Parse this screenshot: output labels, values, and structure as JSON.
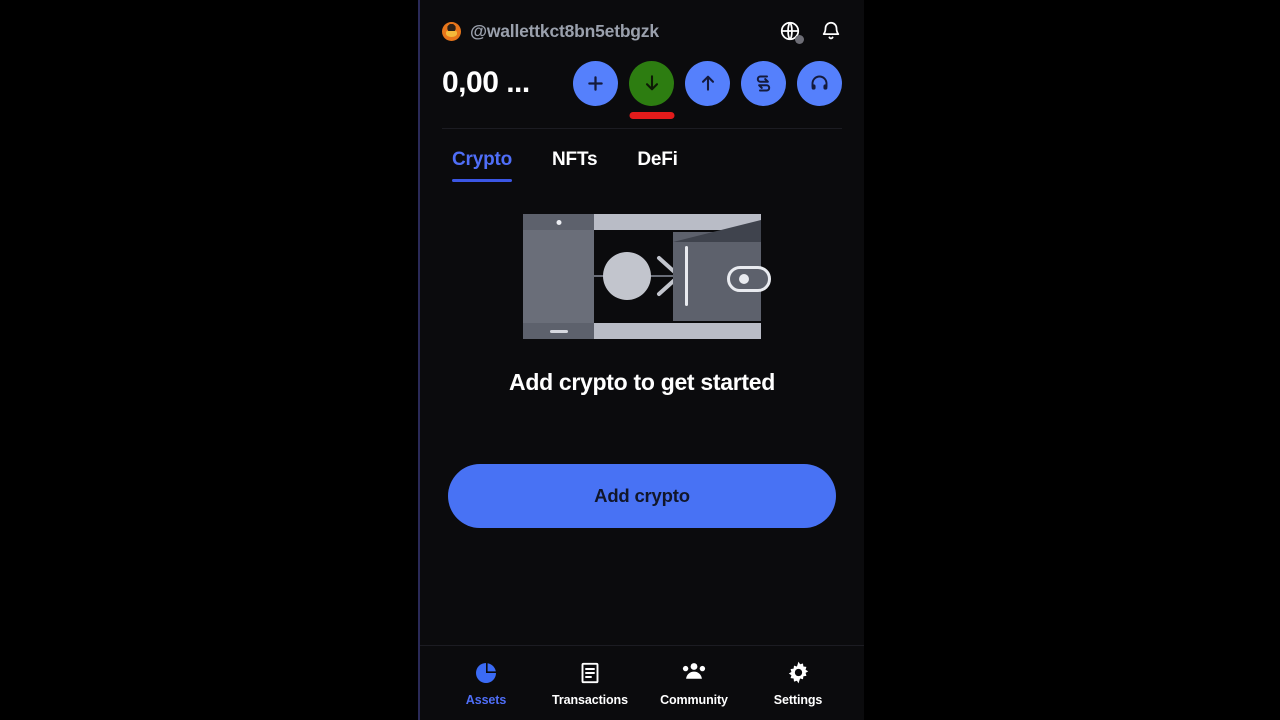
{
  "header": {
    "account_name": "@wallettkct8bn5etbgzk",
    "avatar_icon": "fox-avatar-icon",
    "globe_icon": "globe-icon",
    "bell_icon": "bell-icon",
    "balance": "0,00 ...",
    "actions": [
      {
        "name": "buy",
        "icon": "plus-icon",
        "color": "#5580fc"
      },
      {
        "name": "receive",
        "icon": "arrow-down-icon",
        "color": "#2d7d11",
        "highlight_color": "#e31b1b",
        "highlighted": true
      },
      {
        "name": "send",
        "icon": "arrow-up-icon",
        "color": "#5580fc"
      },
      {
        "name": "swap",
        "icon": "swap-arrows-icon",
        "color": "#5580fc"
      },
      {
        "name": "support",
        "icon": "headphones-icon",
        "color": "#5580fc"
      }
    ]
  },
  "tabs": [
    {
      "label": "Crypto",
      "active": true
    },
    {
      "label": "NFTs",
      "active": false
    },
    {
      "label": "DeFi",
      "active": false
    }
  ],
  "empty_state": {
    "illustration": "phone-coin-to-wallet-illustration",
    "title": "Add crypto to get started",
    "cta_label": "Add crypto",
    "cta_color": "#4872f4"
  },
  "bottom_nav": [
    {
      "label": "Assets",
      "icon": "pie-chart-icon",
      "active": true
    },
    {
      "label": "Transactions",
      "icon": "document-lines-icon",
      "active": false
    },
    {
      "label": "Community",
      "icon": "people-group-icon",
      "active": false
    },
    {
      "label": "Settings",
      "icon": "gear-icon",
      "active": false
    }
  ],
  "theme": {
    "panel_background": "#0b0b0d",
    "page_background": "#000000",
    "accent": "#4f6ef7"
  }
}
